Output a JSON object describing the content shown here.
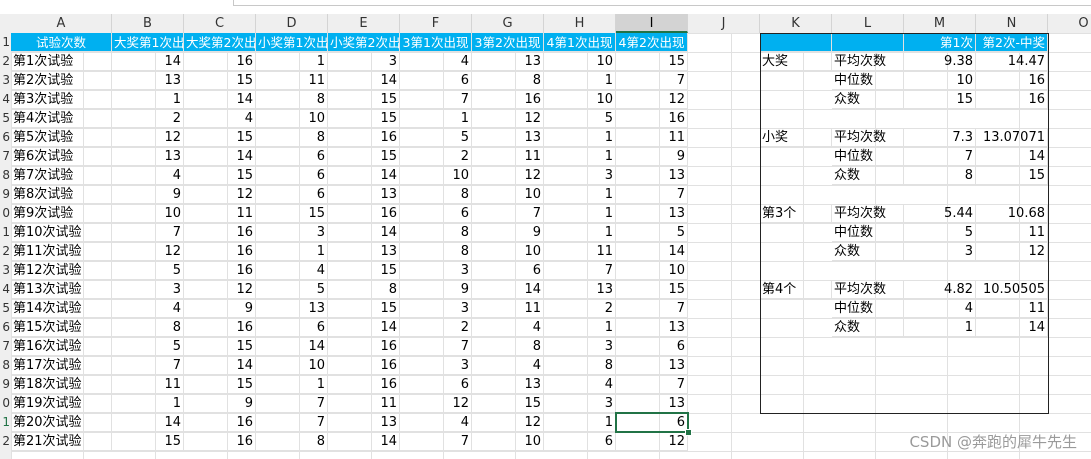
{
  "columns": [
    "A",
    "B",
    "C",
    "D",
    "E",
    "F",
    "G",
    "H",
    "I",
    "J",
    "K",
    "L",
    "M",
    "N",
    "O"
  ],
  "selected_column": "I",
  "row_numbers": [
    "1",
    "2",
    "3",
    "4",
    "5",
    "6",
    "7",
    "8",
    "9",
    "0",
    "1",
    "2",
    "3",
    "4",
    "5",
    "6",
    "7",
    "8",
    "9",
    "0",
    "1",
    "2"
  ],
  "selected_row_index": 20,
  "headers": [
    "试验次数",
    "大奖第1次出",
    "大奖第2次出",
    "小奖第1次出",
    "小奖第2次出",
    "3第1次出现",
    "3第2次出现",
    "4第1次出现",
    "4第2次出现"
  ],
  "rows": [
    [
      "第1次试验",
      "14",
      "16",
      "1",
      "3",
      "4",
      "13",
      "10",
      "15"
    ],
    [
      "第2次试验",
      "13",
      "15",
      "11",
      "14",
      "6",
      "8",
      "1",
      "7"
    ],
    [
      "第3次试验",
      "1",
      "14",
      "8",
      "15",
      "7",
      "16",
      "10",
      "12"
    ],
    [
      "第4次试验",
      "2",
      "4",
      "10",
      "15",
      "1",
      "12",
      "5",
      "16"
    ],
    [
      "第5次试验",
      "12",
      "15",
      "8",
      "16",
      "5",
      "13",
      "1",
      "11"
    ],
    [
      "第6次试验",
      "13",
      "14",
      "6",
      "15",
      "2",
      "11",
      "1",
      "9"
    ],
    [
      "第7次试验",
      "4",
      "15",
      "6",
      "14",
      "10",
      "12",
      "3",
      "13"
    ],
    [
      "第8次试验",
      "9",
      "12",
      "6",
      "13",
      "8",
      "10",
      "1",
      "7"
    ],
    [
      "第9次试验",
      "10",
      "11",
      "15",
      "16",
      "6",
      "7",
      "1",
      "13"
    ],
    [
      "第10次试验",
      "7",
      "16",
      "3",
      "14",
      "8",
      "9",
      "1",
      "5"
    ],
    [
      "第11次试验",
      "12",
      "16",
      "1",
      "13",
      "8",
      "10",
      "11",
      "14"
    ],
    [
      "第12次试验",
      "5",
      "16",
      "4",
      "15",
      "3",
      "6",
      "7",
      "10"
    ],
    [
      "第13次试验",
      "3",
      "12",
      "5",
      "8",
      "9",
      "14",
      "13",
      "15"
    ],
    [
      "第14次试验",
      "4",
      "9",
      "13",
      "15",
      "3",
      "11",
      "2",
      "7"
    ],
    [
      "第15次试验",
      "8",
      "16",
      "6",
      "14",
      "2",
      "4",
      "1",
      "13"
    ],
    [
      "第16次试验",
      "5",
      "15",
      "14",
      "16",
      "7",
      "8",
      "3",
      "6"
    ],
    [
      "第17次试验",
      "7",
      "14",
      "10",
      "16",
      "3",
      "4",
      "8",
      "13"
    ],
    [
      "第18次试验",
      "11",
      "15",
      "1",
      "16",
      "6",
      "13",
      "4",
      "7"
    ],
    [
      "第19次试验",
      "1",
      "9",
      "7",
      "11",
      "12",
      "15",
      "3",
      "13"
    ],
    [
      "第20次试验",
      "14",
      "16",
      "7",
      "13",
      "4",
      "12",
      "1",
      "6"
    ],
    [
      "第21次试验",
      "15",
      "16",
      "8",
      "14",
      "7",
      "10",
      "6",
      "12"
    ]
  ],
  "summary_header": {
    "m": "第1次",
    "n": "第2次-中奖"
  },
  "summary": [
    {
      "group": "大奖",
      "stats": [
        [
          "平均次数",
          "9.38",
          "14.47"
        ],
        [
          "中位数",
          "10",
          "16"
        ],
        [
          "众数",
          "15",
          "16"
        ]
      ]
    },
    {
      "group": "小奖",
      "stats": [
        [
          "平均次数",
          "7.3",
          "13.07071"
        ],
        [
          "中位数",
          "7",
          "14"
        ],
        [
          "众数",
          "8",
          "15"
        ]
      ]
    },
    {
      "group": "第3个",
      "stats": [
        [
          "平均次数",
          "5.44",
          "10.68"
        ],
        [
          "中位数",
          "5",
          "11"
        ],
        [
          "众数",
          "3",
          "12"
        ]
      ]
    },
    {
      "group": "第4个",
      "stats": [
        [
          "平均次数",
          "4.82",
          "10.50505"
        ],
        [
          "中位数",
          "4",
          "11"
        ],
        [
          "众数",
          "1",
          "14"
        ]
      ]
    }
  ],
  "watermark": "CSDN @奔跑的犀牛先生"
}
